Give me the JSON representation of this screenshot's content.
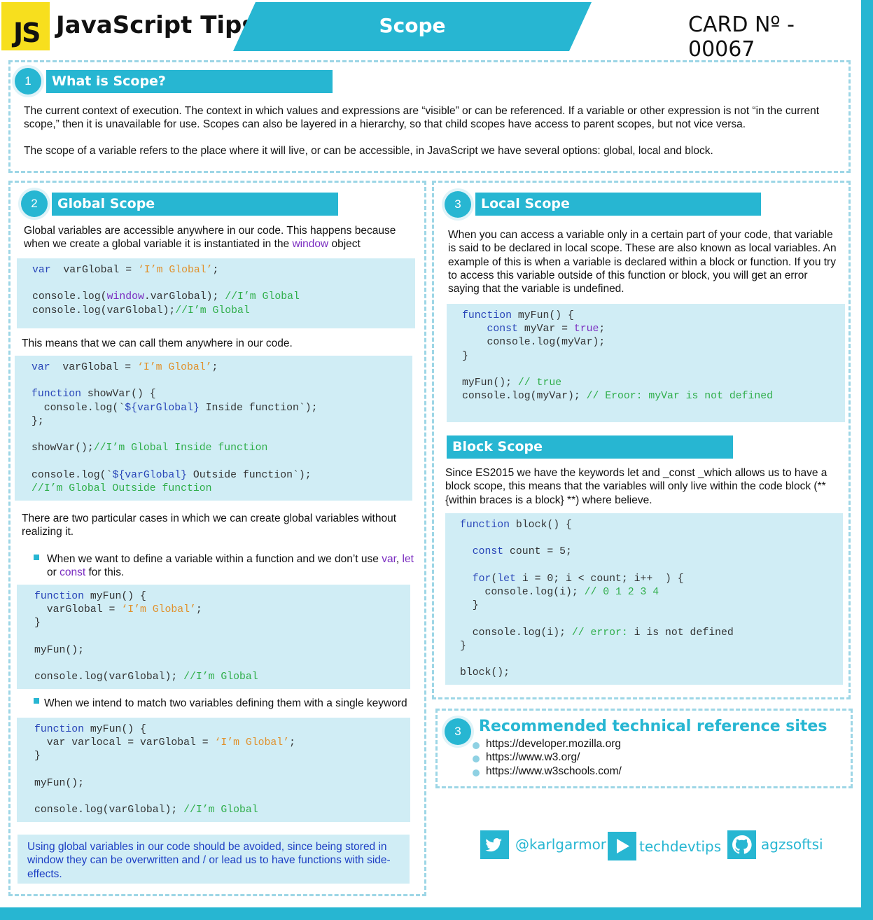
{
  "header": {
    "logo": "JS",
    "brand": "JavaScript Tips",
    "topic": "Scope",
    "card_number": "CARD Nº - 00067"
  },
  "section1": {
    "number": "1",
    "title": "What is Scope?",
    "p1": "The current context of execution. The context in which values and expressions are “visible” or can be referenced. If a variable or other expression is not “in the current scope,” then it is unavailable for use. Scopes can also be layered in a hierarchy, so that child scopes have access to parent scopes, but not vice versa.",
    "p2": "The scope of a variable refers to the place where it will live, or can be accessible, in JavaScript we have several options: global, local and block."
  },
  "global": {
    "number": "2",
    "title": "Global Scope",
    "intro_a": "Global variables are accessible anywhere in our code. This happens because when we create a global variable it is instantiated in the",
    "intro_window": "window",
    "intro_b": "object",
    "anywhere": "This means that we can call them anywhere in our code.",
    "cases": "There are two particular cases in which we can create global variables without realizing it.",
    "case1_a": "When we want to define a variable within a function and we don’t use",
    "case1_var": "var",
    "case1_comma": ",",
    "case1_let": "let",
    "case1_or": "or",
    "case1_const": "const",
    "case1_b": "for this.",
    "case2": "When we intend to match two variables defining them with a single keyword",
    "note": "Using global variables in our code should be avoided, since being stored in window they can be overwritten and / or lead us to have functions with side-effects."
  },
  "local": {
    "number": "3",
    "title": "Local Scope",
    "intro": "When you can access a variable only in a certain part of your code, that variable is said to be declared in local scope. These are also known as local variables. An example of this is when a variable is declared within a block or function. If you try to access this variable outside of this function or block, you will get an error saying that the variable is undefined."
  },
  "block": {
    "title": "Block Scope",
    "intro": "Since ES2015 we have the keywords let and _const _which allows us to have a block scope, this means that the variables will only live within the code block (** {within braces is a block} **) where believe."
  },
  "references": {
    "number": "3",
    "title": "Recommended technical reference sites",
    "links": [
      "https://developer.mozilla.org",
      "https://www.w3.org/",
      "https://www.w3schools.com/"
    ]
  },
  "social": {
    "twitter": "@karlgarmor",
    "youtube": "techdevtips",
    "github": "agzsoftsi"
  },
  "code": {
    "g1": [
      [
        [
          "kw",
          "var"
        ],
        [
          "",
          "  varGlobal = "
        ],
        [
          "str",
          "‘I’m Global’"
        ],
        [
          "",
          ";"
        ]
      ],
      [],
      [
        [
          "",
          "console.log("
        ],
        [
          "pu",
          "window"
        ],
        [
          "",
          ".varGlobal); "
        ],
        [
          "cm",
          "//I’m Global"
        ]
      ],
      [
        [
          "",
          "console.log(varGlobal);"
        ],
        [
          "cm",
          "//I’m Global"
        ]
      ]
    ],
    "g2": [
      [
        [
          "kw",
          "var"
        ],
        [
          "",
          "  varGlobal = "
        ],
        [
          "str",
          "‘I’m Global’"
        ],
        [
          "",
          ";"
        ]
      ],
      [],
      [
        [
          "kw",
          "function"
        ],
        [
          "",
          " showVar() {"
        ]
      ],
      [
        [
          "",
          "  console.log(`"
        ],
        [
          "kw",
          "${varGlobal}"
        ],
        [
          "",
          " Inside function`);"
        ]
      ],
      [
        [
          "",
          "};"
        ]
      ],
      [],
      [
        [
          "",
          "showVar();"
        ],
        [
          "cm",
          "//I’m Global Inside function"
        ]
      ],
      [],
      [
        [
          "",
          "console.log(`"
        ],
        [
          "kw",
          "${varGlobal}"
        ],
        [
          "",
          " Outside function`);"
        ]
      ],
      [
        [
          "cm",
          "//I’m Global Outside function"
        ]
      ]
    ],
    "g3": [
      [
        [
          "kw",
          "function"
        ],
        [
          "",
          " myFun() {"
        ]
      ],
      [
        [
          "",
          "  varGlobal = "
        ],
        [
          "str",
          "‘I’m Global’"
        ],
        [
          "",
          ";"
        ]
      ],
      [
        [
          "",
          "}"
        ]
      ],
      [],
      [
        [
          "",
          "myFun();"
        ]
      ],
      [],
      [
        [
          "",
          "console.log(varGlobal); "
        ],
        [
          "cm",
          "//I’m Global"
        ]
      ]
    ],
    "g4": [
      [
        [
          "kw",
          "function"
        ],
        [
          "",
          " myFun() {"
        ]
      ],
      [
        [
          "",
          "  var varlocal = varGlobal = "
        ],
        [
          "str",
          "‘I’m Global’"
        ],
        [
          "",
          ";"
        ]
      ],
      [
        [
          "",
          "}"
        ]
      ],
      [],
      [
        [
          "",
          "myFun();"
        ]
      ],
      [],
      [
        [
          "",
          "console.log(varGlobal); "
        ],
        [
          "cm",
          "//I’m Global"
        ]
      ]
    ],
    "l1": [
      [
        [
          "kw",
          "function"
        ],
        [
          "",
          " myFun() {"
        ]
      ],
      [
        [
          "",
          "    "
        ],
        [
          "kw",
          "const"
        ],
        [
          "",
          " myVar = "
        ],
        [
          "pu",
          "true"
        ],
        [
          "",
          ";"
        ]
      ],
      [
        [
          "",
          "    console.log(myVar);"
        ]
      ],
      [
        [
          "",
          "}"
        ]
      ],
      [],
      [
        [
          "",
          "myFun(); "
        ],
        [
          "cm",
          "// true"
        ]
      ],
      [
        [
          "",
          "console.log(myVar); "
        ],
        [
          "cm",
          "// Eroor: myVar is not defined"
        ]
      ]
    ],
    "b1": [
      [
        [
          "kw",
          "function"
        ],
        [
          "",
          " block() {"
        ]
      ],
      [],
      [
        [
          "",
          "  "
        ],
        [
          "kw",
          "const"
        ],
        [
          "",
          " count = 5;"
        ]
      ],
      [],
      [
        [
          "",
          "  "
        ],
        [
          "kw",
          "for"
        ],
        [
          "",
          "("
        ],
        [
          "kw",
          "let"
        ],
        [
          "",
          " i = 0; i < count; i++  ) {"
        ]
      ],
      [
        [
          "",
          "    console.log(i); "
        ],
        [
          "cm",
          "// 0 1 2 3 4"
        ]
      ],
      [
        [
          "",
          "  }"
        ]
      ],
      [],
      [
        [
          "",
          "  console.log(i); "
        ],
        [
          "cm",
          "// error:"
        ],
        [
          "",
          " i is not defined"
        ]
      ],
      [
        [
          "",
          "}"
        ]
      ],
      [],
      [
        [
          "",
          "block();"
        ]
      ]
    ]
  }
}
